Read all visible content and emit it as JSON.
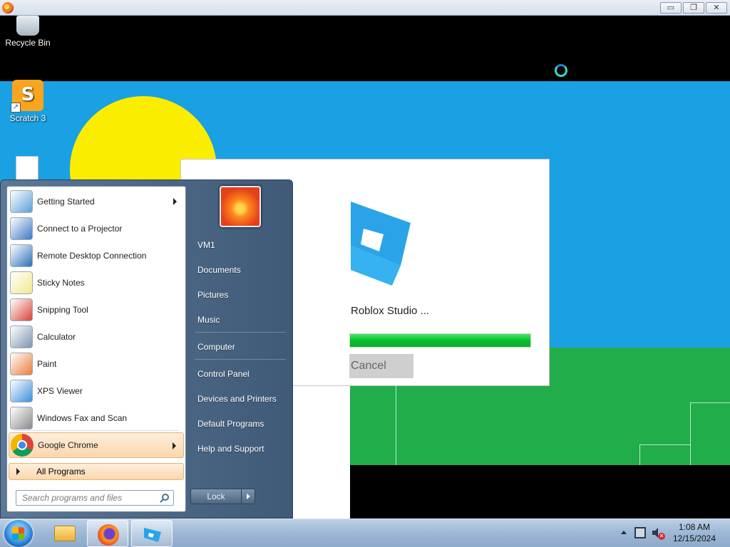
{
  "desktop": {
    "icons": [
      {
        "label": "Recycle Bin",
        "icon": "recycle-bin-icon"
      },
      {
        "label": "Scratch 3",
        "icon": "scratch-icon"
      }
    ]
  },
  "installer": {
    "title": "Roblox Studio ...",
    "progress_fraction": 1.0,
    "cancel_label": "Cancel",
    "colors": {
      "progress": "#06c12c",
      "logo": "#2aa3e8"
    }
  },
  "start_menu": {
    "programs": [
      {
        "label": "Getting Started",
        "icon": "getting-started-icon",
        "submenu": true
      },
      {
        "label": "Connect to a Projector",
        "icon": "projector-icon",
        "submenu": false
      },
      {
        "label": "Remote Desktop Connection",
        "icon": "remote-desktop-icon",
        "submenu": false
      },
      {
        "label": "Sticky Notes",
        "icon": "sticky-notes-icon",
        "submenu": false
      },
      {
        "label": "Snipping Tool",
        "icon": "snipping-tool-icon",
        "submenu": false
      },
      {
        "label": "Calculator",
        "icon": "calculator-icon",
        "submenu": false
      },
      {
        "label": "Paint",
        "icon": "paint-icon",
        "submenu": false
      },
      {
        "label": "XPS Viewer",
        "icon": "xps-viewer-icon",
        "submenu": false
      },
      {
        "label": "Windows Fax and Scan",
        "icon": "fax-scan-icon",
        "submenu": false
      },
      {
        "label": "Google Chrome",
        "icon": "chrome-icon",
        "submenu": true
      }
    ],
    "all_programs_label": "All Programs",
    "search_placeholder": "Search programs and files",
    "right_items": [
      {
        "label": "VM1"
      },
      {
        "label": "Documents"
      },
      {
        "label": "Pictures"
      },
      {
        "label": "Music"
      },
      {
        "label": "Computer"
      },
      {
        "label": "Control Panel"
      },
      {
        "label": "Devices and Printers"
      },
      {
        "label": "Default Programs"
      },
      {
        "label": "Help and Support"
      }
    ],
    "lock_label": "Lock"
  },
  "taskbar": {
    "pinned": [
      {
        "icon": "windows-explorer-icon",
        "active": false
      },
      {
        "icon": "firefox-icon",
        "active": true
      },
      {
        "icon": "roblox-studio-icon",
        "active": true
      }
    ],
    "clock_time": "1:08 AM",
    "clock_date": "12/15/2024"
  },
  "window_controls": {
    "minimize": "▭",
    "restore": "❐",
    "close": "✕"
  }
}
